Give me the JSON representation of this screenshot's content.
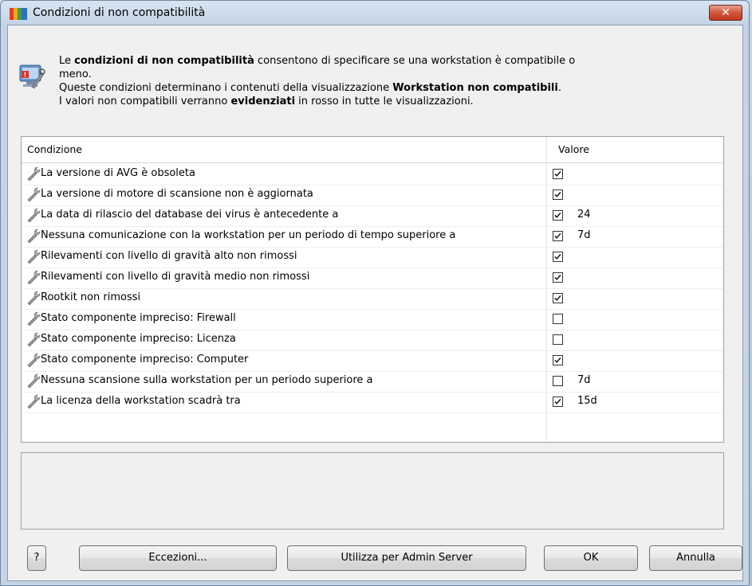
{
  "window": {
    "title": "Condizioni di non compatibilità",
    "close_glyph": "✕"
  },
  "info": {
    "line1_pre": "Le ",
    "line1_bold": "condizioni di non compatibilità",
    "line1_post": " consentono di specificare se una workstation è compatibile o",
    "line2": "meno.",
    "line3_pre": "Queste condizioni determinano i contenuti della visualizzazione ",
    "line3_bold": "Workstation non compatibili",
    "line3_post": ".",
    "line4_pre": "I valori non compatibili verranno ",
    "line4_bold": "evidenziati",
    "line4_post": " in rosso in tutte le visualizzazioni."
  },
  "table": {
    "col_condition": "Condizione",
    "col_value": "Valore",
    "rows": [
      {
        "condition": "La versione di AVG è obsoleta",
        "checked": true,
        "value": ""
      },
      {
        "condition": "La versione di motore di scansione non è aggiornata",
        "checked": true,
        "value": ""
      },
      {
        "condition": "La data di rilascio del database dei virus è antecedente a",
        "checked": true,
        "value": "24"
      },
      {
        "condition": "Nessuna comunicazione con la workstation per un periodo di tempo superiore a",
        "checked": true,
        "value": "7d"
      },
      {
        "condition": "Rilevamenti con livello di gravità alto non rimossi",
        "checked": true,
        "value": ""
      },
      {
        "condition": "Rilevamenti con livello di gravità medio non rimossi",
        "checked": true,
        "value": ""
      },
      {
        "condition": "Rootkit non rimossi",
        "checked": true,
        "value": ""
      },
      {
        "condition": "Stato componente impreciso: Firewall",
        "checked": false,
        "value": ""
      },
      {
        "condition": "Stato componente impreciso: Licenza",
        "checked": false,
        "value": ""
      },
      {
        "condition": "Stato componente impreciso: Computer",
        "checked": true,
        "value": ""
      },
      {
        "condition": "Nessuna scansione sulla workstation per un periodo superiore a",
        "checked": false,
        "value": "7d"
      },
      {
        "condition": "La licenza della workstation scadrà tra",
        "checked": true,
        "value": "15d"
      }
    ]
  },
  "buttons": {
    "help": "?",
    "exceptions": "Eccezioni...",
    "use_admin": "Utilizza per Admin Server",
    "ok": "OK",
    "cancel": "Annulla"
  },
  "icons": {
    "app": "avg-logo-icon",
    "info": "workstation-wrench-icon",
    "row": "wrench-icon"
  }
}
